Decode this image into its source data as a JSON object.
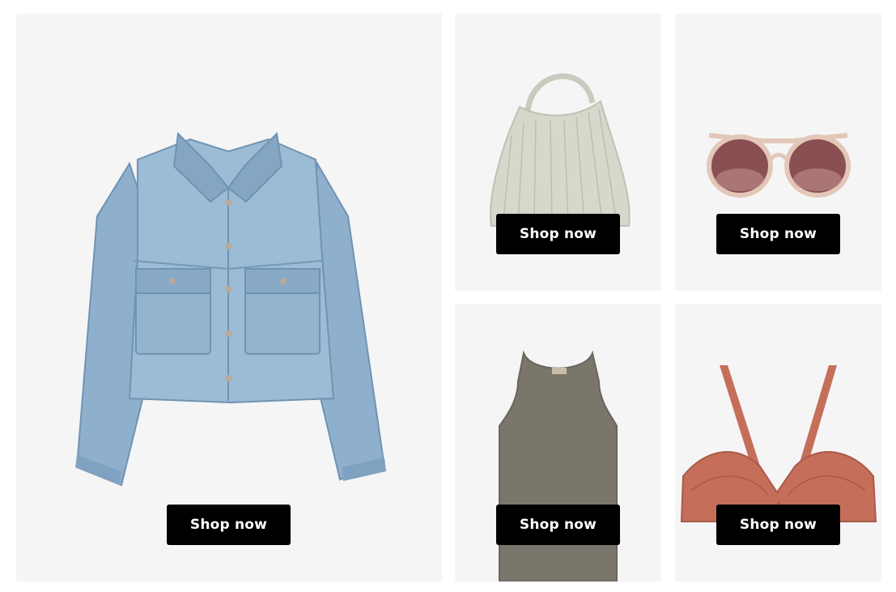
{
  "products": [
    {
      "id": "jacket",
      "image": "denim-jacket-image",
      "cta_label": "Shop now"
    },
    {
      "id": "bag",
      "image": "pleated-hobo-bag-image",
      "cta_label": "Shop now"
    },
    {
      "id": "sunglasses",
      "image": "round-sunglasses-image",
      "cta_label": "Shop now"
    },
    {
      "id": "tank",
      "image": "knit-tank-top-image",
      "cta_label": "Shop now"
    },
    {
      "id": "bra",
      "image": "lace-bra-image",
      "cta_label": "Shop now"
    }
  ],
  "colors": {
    "tile_background": "#f5f5f5",
    "button_background": "#000000",
    "button_text": "#ffffff",
    "denim": "#8fb0cc",
    "bag": "#d6d8cc",
    "sunglasses_frame": "#e3c7b8",
    "lens": "#8a4f52",
    "tank": "#7b766c",
    "bra": "#c56f5b"
  }
}
